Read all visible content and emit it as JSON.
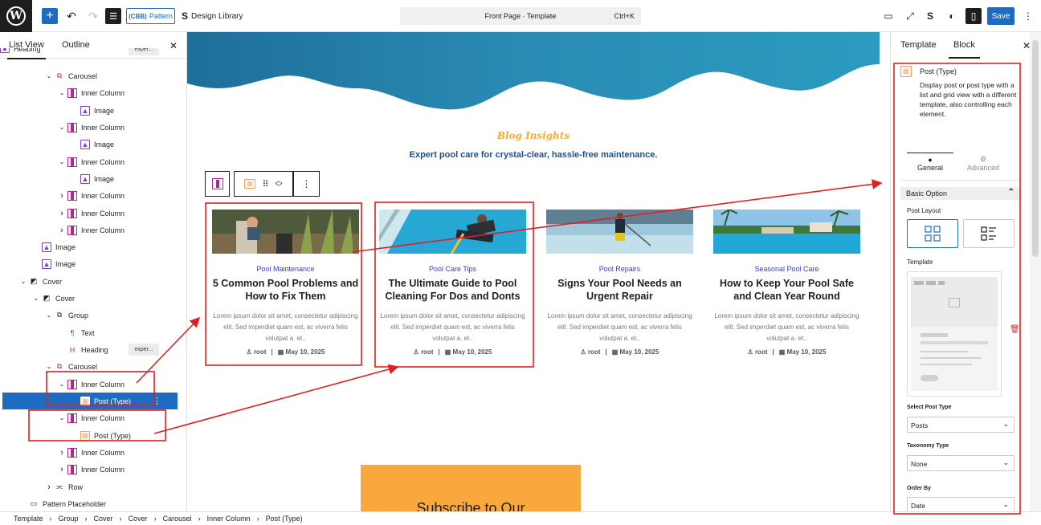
{
  "topbar": {
    "pattern_label": "Pattern",
    "pattern_prefix": "(CBB)",
    "design_library": "Design Library",
    "command_title": "Front Page · Template",
    "command_shortcut": "Ctrl+K",
    "save_label": "Save"
  },
  "left_panel": {
    "tabs": [
      "List View",
      "Outline"
    ],
    "rows": [
      {
        "label": "Heading",
        "badge": "exper..."
      },
      {
        "label": "Carousel"
      },
      {
        "label": "Inner Column"
      },
      {
        "label": "Image"
      },
      {
        "label": "Inner Column"
      },
      {
        "label": "Image"
      },
      {
        "label": "Inner Column"
      },
      {
        "label": "Image"
      },
      {
        "label": "Inner Column"
      },
      {
        "label": "Inner Column"
      },
      {
        "label": "Inner Column"
      },
      {
        "label": "Image"
      },
      {
        "label": "Image"
      },
      {
        "label": "Cover"
      },
      {
        "label": "Cover"
      },
      {
        "label": "Group"
      },
      {
        "label": "Text"
      },
      {
        "label": "Heading",
        "badge": "exper..."
      },
      {
        "label": "Carousel"
      },
      {
        "label": "Inner Column"
      },
      {
        "label": "Post (Type)"
      },
      {
        "label": "Inner Column"
      },
      {
        "label": "Post (Type)"
      },
      {
        "label": "Inner Column"
      },
      {
        "label": "Inner Column"
      },
      {
        "label": "Row"
      },
      {
        "label": "Pattern Placeholder"
      }
    ]
  },
  "canvas": {
    "blog_insights": "Blog Insights",
    "blog_subtitle": "Expert pool care for crystal-clear, hassle-free maintenance.",
    "cards": [
      {
        "category": "Pool Maintenance",
        "title": "5 Common Pool Problems and How to Fix Them",
        "excerpt": "Lorem ipsum dolor sit amet, consectetur adipiscing elit. Sed imperdiet quam est, ac viverra felis volutpat a. et..",
        "author": "root",
        "date": "May 10, 2025"
      },
      {
        "category": "Pool Care Tips",
        "title": "The Ultimate Guide to Pool Cleaning For Dos and Donts",
        "excerpt": "Lorem ipsum dolor sit amet, consectetur adipiscing elit. Sed imperdiet quam est, ac viverra felis volutpat a. et..",
        "author": "root",
        "date": "May 10, 2025"
      },
      {
        "category": "Pool Repairs",
        "title": "Signs Your Pool Needs an Urgent Repair",
        "excerpt": "Lorem ipsum dolor sit amet, consectetur adipiscing elit. Sed imperdiet quam est, ac viverra felis volutpat a. et..",
        "author": "root",
        "date": "May 10, 2025"
      },
      {
        "category": "Seasonal Pool Care",
        "title": "How to Keep Your Pool Safe and Clean Year Round",
        "excerpt": "Lorem ipsum dolor sit amet, consectetur adipiscing elit. Sed imperdiet quam est, ac viverra felis volutpat a. et..",
        "author": "root",
        "date": "May 10, 2025"
      }
    ],
    "subscribe": "Subscribe to Our"
  },
  "right_panel": {
    "tabs": [
      "Template",
      "Block"
    ],
    "block_name": "Post (Type)",
    "block_desc": "Display post or post type with a list and grid view with a different template, also controlling each element.",
    "sub_tabs": [
      "General",
      "Advanced"
    ],
    "basic_option": "Basic Option",
    "post_layout": "Post Layout",
    "template": "Template",
    "select_post_type_label": "Select Post Type",
    "select_post_type_value": "Posts",
    "taxonomy_label": "Taxonomy Type",
    "taxonomy_value": "None",
    "order_by_label": "Order By",
    "order_by_value": "Date"
  },
  "breadcrumb": [
    "Template",
    "Group",
    "Cover",
    "Cover",
    "Carousel",
    "Inner Column",
    "Post (Type)"
  ],
  "colors": {
    "accent": "#1e6cc2",
    "annotation": "#e02020",
    "wave": "#2a8cb5",
    "subscribe": "#f9a83e"
  }
}
